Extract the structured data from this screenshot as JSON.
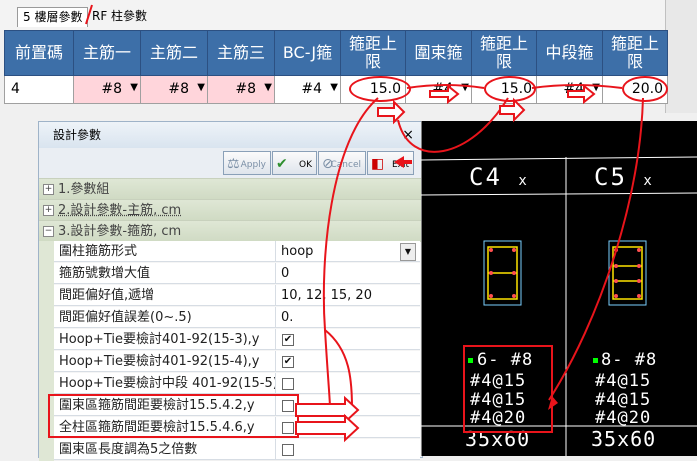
{
  "tabs": [
    {
      "label": "5 樓層參數"
    },
    {
      "label": "RF  柱參數"
    }
  ],
  "grid": {
    "headers": [
      "前置碼",
      "主筋一",
      "主筋二",
      "主筋三",
      "BC-J箍",
      "箍距上\n限",
      "圍束箍",
      "箍距上\n限",
      "中段箍",
      "箍距上\n限"
    ],
    "row": {
      "prefix": "4",
      "main1": "#8",
      "main2": "#8",
      "main3": "#8",
      "bcj": "#4",
      "spacing1": "15.0",
      "confining": "#4",
      "spacing2": "15.0",
      "middle": "#4",
      "spacing3": "20.0"
    }
  },
  "dialog": {
    "title": "設計參數",
    "close": "×",
    "toolbar": {
      "apply": "Apply",
      "ok": "OK",
      "cancel": "Cancel",
      "exit": "Exit"
    },
    "sections": [
      {
        "label": "1.參數組",
        "toggle": "+"
      },
      {
        "label": "2.設計參數-主筋, cm",
        "toggle": "+"
      },
      {
        "label": "3.設計參數-箍筋, cm",
        "toggle": "−"
      }
    ],
    "properties": [
      {
        "label": "圍柱箍筋形式",
        "value": "hoop"
      },
      {
        "label": "箍筋號數增大值",
        "value": "0"
      },
      {
        "label": "間距偏好值,遞增",
        "value": "10, 12, 15, 20"
      },
      {
        "label": "間距偏好值誤差(0~.5)",
        "value": "0."
      },
      {
        "label": "Hoop+Tie要檢討401-92(15-3),y",
        "value": "✔"
      },
      {
        "label": "Hoop+Tie要檢討401-92(15-4),y",
        "value": "✔"
      },
      {
        "label": "Hoop+Tie要檢討中段 401-92(15-5)",
        "value": ""
      },
      {
        "label": "圍束區箍筋間距要檢討15.5.4.2,y",
        "value": ""
      },
      {
        "label": "全柱區箍筋間距要檢討15.5.4.6,y",
        "value": ""
      },
      {
        "label": "圍束區長度調為5之倍數",
        "value": ""
      }
    ]
  },
  "cad": {
    "columns": [
      {
        "id": "C4",
        "suffix": "x",
        "bars": "6- #8",
        "tie1": "#4@15",
        "tie2": "#4@15",
        "tie3": "#4@20",
        "size": "35x60"
      },
      {
        "id": "C5",
        "suffix": "x",
        "bars": "8- #8",
        "tie1": "#4@15",
        "tie2": "#4@15",
        "tie3": "#4@20",
        "size": "35x60"
      }
    ]
  },
  "colors": {
    "header": "#3d6fa8",
    "annotation": "#e8141b",
    "pink_cell": "#ffd5db",
    "cad_background": "#000000",
    "cad_line": "#ffffff"
  }
}
